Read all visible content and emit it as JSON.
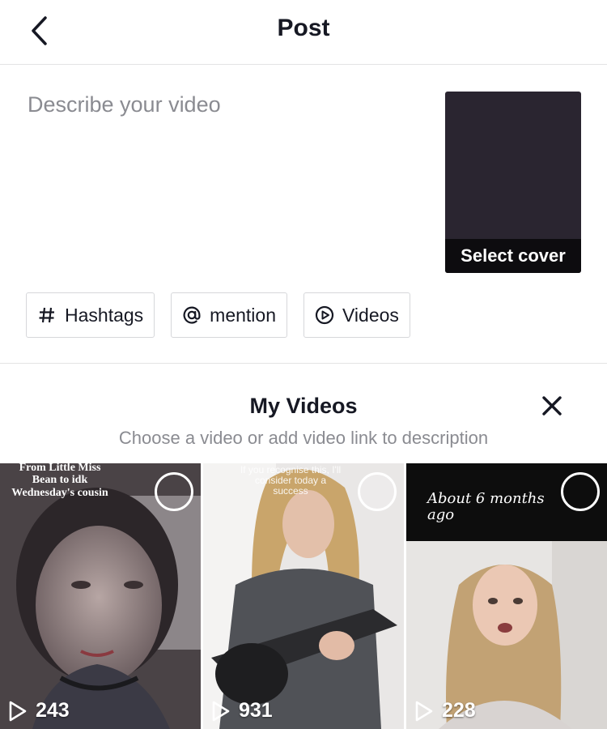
{
  "header": {
    "title": "Post"
  },
  "description": {
    "placeholder": "Describe your video"
  },
  "cover": {
    "label": "Select cover"
  },
  "chips": [
    {
      "label": "Hashtags",
      "icon": "hashtag-icon"
    },
    {
      "label": "mention",
      "icon": "at-icon"
    },
    {
      "label": "Videos",
      "icon": "play-circle-icon"
    }
  ],
  "panel": {
    "title": "My Videos",
    "subtitle": "Choose a video or add video link to description"
  },
  "videos": [
    {
      "views": "243",
      "caption": [
        "From Little Miss",
        "Bean to idk",
        "Wednesday's cousin"
      ]
    },
    {
      "views": "931",
      "caption": [
        "If you recognise this, I'll",
        "consider today a",
        "success"
      ]
    },
    {
      "views": "228",
      "caption": [
        "About 6 months ago"
      ]
    }
  ],
  "colors": {
    "accent": "#161823",
    "muted": "#8a8b91",
    "cover_bg": "#2a2530"
  }
}
